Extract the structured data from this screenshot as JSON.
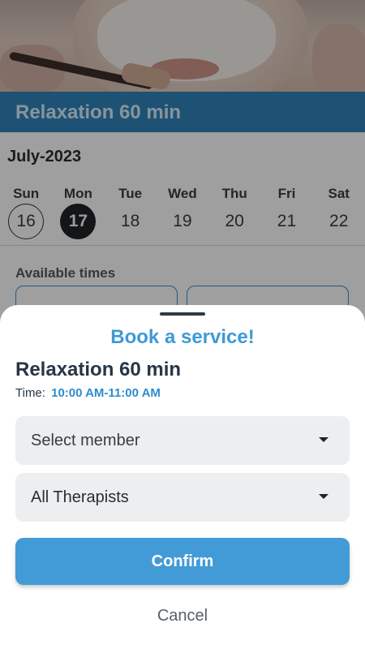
{
  "background": {
    "service_title": "Relaxation 60 min",
    "month": "July-2023",
    "week": [
      {
        "dow": "Sun",
        "num": "16",
        "state": "today"
      },
      {
        "dow": "Mon",
        "num": "17",
        "state": "selected"
      },
      {
        "dow": "Tue",
        "num": "18",
        "state": "normal"
      },
      {
        "dow": "Wed",
        "num": "19",
        "state": "normal"
      },
      {
        "dow": "Thu",
        "num": "20",
        "state": "normal"
      },
      {
        "dow": "Fri",
        "num": "21",
        "state": "normal"
      },
      {
        "dow": "Sat",
        "num": "22",
        "state": "normal"
      }
    ],
    "available_label": "Available times"
  },
  "sheet": {
    "title": "Book a service!",
    "service_name": "Relaxation 60 min",
    "time_label": "Time:",
    "time_value": "10:00 AM-11:00 AM",
    "member_select": "Select member",
    "therapist_select": "All Therapists",
    "confirm_label": "Confirm",
    "cancel_label": "Cancel"
  },
  "colors": {
    "accent": "#429bd6",
    "service_bar": "#2f7fb3",
    "selected_day": "#202124"
  }
}
